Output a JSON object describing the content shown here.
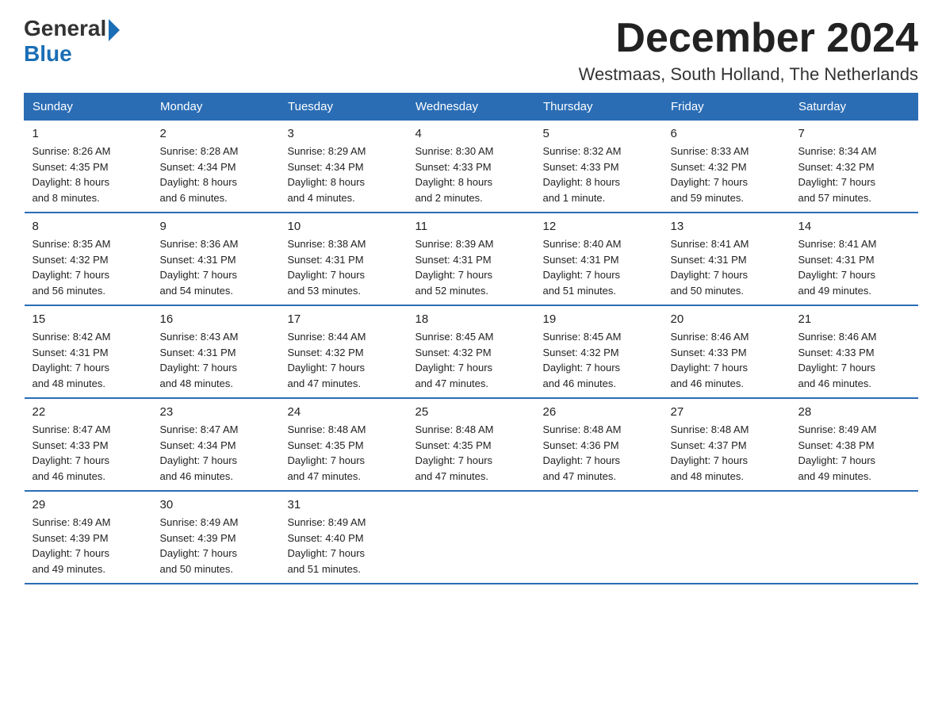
{
  "logo": {
    "general": "General",
    "blue": "Blue"
  },
  "title": "December 2024",
  "location": "Westmaas, South Holland, The Netherlands",
  "days_of_week": [
    "Sunday",
    "Monday",
    "Tuesday",
    "Wednesday",
    "Thursday",
    "Friday",
    "Saturday"
  ],
  "weeks": [
    [
      {
        "day": "1",
        "sunrise": "8:26 AM",
        "sunset": "4:35 PM",
        "daylight": "8 hours and 8 minutes."
      },
      {
        "day": "2",
        "sunrise": "8:28 AM",
        "sunset": "4:34 PM",
        "daylight": "8 hours and 6 minutes."
      },
      {
        "day": "3",
        "sunrise": "8:29 AM",
        "sunset": "4:34 PM",
        "daylight": "8 hours and 4 minutes."
      },
      {
        "day": "4",
        "sunrise": "8:30 AM",
        "sunset": "4:33 PM",
        "daylight": "8 hours and 2 minutes."
      },
      {
        "day": "5",
        "sunrise": "8:32 AM",
        "sunset": "4:33 PM",
        "daylight": "8 hours and 1 minute."
      },
      {
        "day": "6",
        "sunrise": "8:33 AM",
        "sunset": "4:32 PM",
        "daylight": "7 hours and 59 minutes."
      },
      {
        "day": "7",
        "sunrise": "8:34 AM",
        "sunset": "4:32 PM",
        "daylight": "7 hours and 57 minutes."
      }
    ],
    [
      {
        "day": "8",
        "sunrise": "8:35 AM",
        "sunset": "4:32 PM",
        "daylight": "7 hours and 56 minutes."
      },
      {
        "day": "9",
        "sunrise": "8:36 AM",
        "sunset": "4:31 PM",
        "daylight": "7 hours and 54 minutes."
      },
      {
        "day": "10",
        "sunrise": "8:38 AM",
        "sunset": "4:31 PM",
        "daylight": "7 hours and 53 minutes."
      },
      {
        "day": "11",
        "sunrise": "8:39 AM",
        "sunset": "4:31 PM",
        "daylight": "7 hours and 52 minutes."
      },
      {
        "day": "12",
        "sunrise": "8:40 AM",
        "sunset": "4:31 PM",
        "daylight": "7 hours and 51 minutes."
      },
      {
        "day": "13",
        "sunrise": "8:41 AM",
        "sunset": "4:31 PM",
        "daylight": "7 hours and 50 minutes."
      },
      {
        "day": "14",
        "sunrise": "8:41 AM",
        "sunset": "4:31 PM",
        "daylight": "7 hours and 49 minutes."
      }
    ],
    [
      {
        "day": "15",
        "sunrise": "8:42 AM",
        "sunset": "4:31 PM",
        "daylight": "7 hours and 48 minutes."
      },
      {
        "day": "16",
        "sunrise": "8:43 AM",
        "sunset": "4:31 PM",
        "daylight": "7 hours and 48 minutes."
      },
      {
        "day": "17",
        "sunrise": "8:44 AM",
        "sunset": "4:32 PM",
        "daylight": "7 hours and 47 minutes."
      },
      {
        "day": "18",
        "sunrise": "8:45 AM",
        "sunset": "4:32 PM",
        "daylight": "7 hours and 47 minutes."
      },
      {
        "day": "19",
        "sunrise": "8:45 AM",
        "sunset": "4:32 PM",
        "daylight": "7 hours and 46 minutes."
      },
      {
        "day": "20",
        "sunrise": "8:46 AM",
        "sunset": "4:33 PM",
        "daylight": "7 hours and 46 minutes."
      },
      {
        "day": "21",
        "sunrise": "8:46 AM",
        "sunset": "4:33 PM",
        "daylight": "7 hours and 46 minutes."
      }
    ],
    [
      {
        "day": "22",
        "sunrise": "8:47 AM",
        "sunset": "4:33 PM",
        "daylight": "7 hours and 46 minutes."
      },
      {
        "day": "23",
        "sunrise": "8:47 AM",
        "sunset": "4:34 PM",
        "daylight": "7 hours and 46 minutes."
      },
      {
        "day": "24",
        "sunrise": "8:48 AM",
        "sunset": "4:35 PM",
        "daylight": "7 hours and 47 minutes."
      },
      {
        "day": "25",
        "sunrise": "8:48 AM",
        "sunset": "4:35 PM",
        "daylight": "7 hours and 47 minutes."
      },
      {
        "day": "26",
        "sunrise": "8:48 AM",
        "sunset": "4:36 PM",
        "daylight": "7 hours and 47 minutes."
      },
      {
        "day": "27",
        "sunrise": "8:48 AM",
        "sunset": "4:37 PM",
        "daylight": "7 hours and 48 minutes."
      },
      {
        "day": "28",
        "sunrise": "8:49 AM",
        "sunset": "4:38 PM",
        "daylight": "7 hours and 49 minutes."
      }
    ],
    [
      {
        "day": "29",
        "sunrise": "8:49 AM",
        "sunset": "4:39 PM",
        "daylight": "7 hours and 49 minutes."
      },
      {
        "day": "30",
        "sunrise": "8:49 AM",
        "sunset": "4:39 PM",
        "daylight": "7 hours and 50 minutes."
      },
      {
        "day": "31",
        "sunrise": "8:49 AM",
        "sunset": "4:40 PM",
        "daylight": "7 hours and 51 minutes."
      },
      null,
      null,
      null,
      null
    ]
  ],
  "labels": {
    "sunrise": "Sunrise:",
    "sunset": "Sunset:",
    "daylight": "Daylight:"
  }
}
